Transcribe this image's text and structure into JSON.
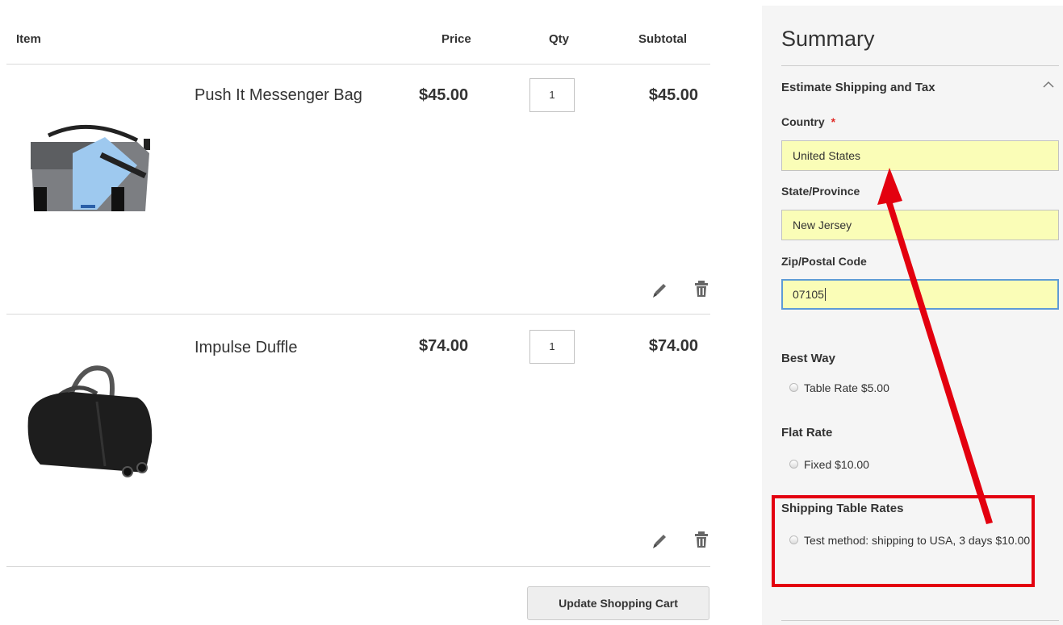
{
  "cart": {
    "headers": {
      "item": "Item",
      "price": "Price",
      "qty": "Qty",
      "subtotal": "Subtotal"
    },
    "items": [
      {
        "name": "Push It Messenger Bag",
        "price": "$45.00",
        "qty": "1",
        "subtotal": "$45.00",
        "image": "messenger-bag-image"
      },
      {
        "name": "Impulse Duffle",
        "price": "$74.00",
        "qty": "1",
        "subtotal": "$74.00",
        "image": "duffle-bag-image"
      }
    ],
    "update_label": "Update Shopping Cart"
  },
  "summary": {
    "title": "Summary",
    "estimate_title": "Estimate Shipping and Tax",
    "country_label": "Country",
    "required_mark": "*",
    "country_value": "United States",
    "state_label": "State/Province",
    "state_value": "New Jersey",
    "zip_label": "Zip/Postal Code",
    "zip_value": "07105",
    "methods": [
      {
        "carrier": "Best Way",
        "options": [
          "Table Rate $5.00"
        ]
      },
      {
        "carrier": "Flat Rate",
        "options": [
          "Fixed $10.00"
        ]
      },
      {
        "carrier": "Shipping Table Rates",
        "options": [
          "Test method: shipping to USA, 3 days $10.00"
        ]
      }
    ]
  },
  "annotation": {
    "color": "#e3000f"
  },
  "colors": {
    "field_bg": "#fafdb7",
    "focus_border": "#5e9bd6",
    "summary_bg": "#f5f5f5"
  }
}
